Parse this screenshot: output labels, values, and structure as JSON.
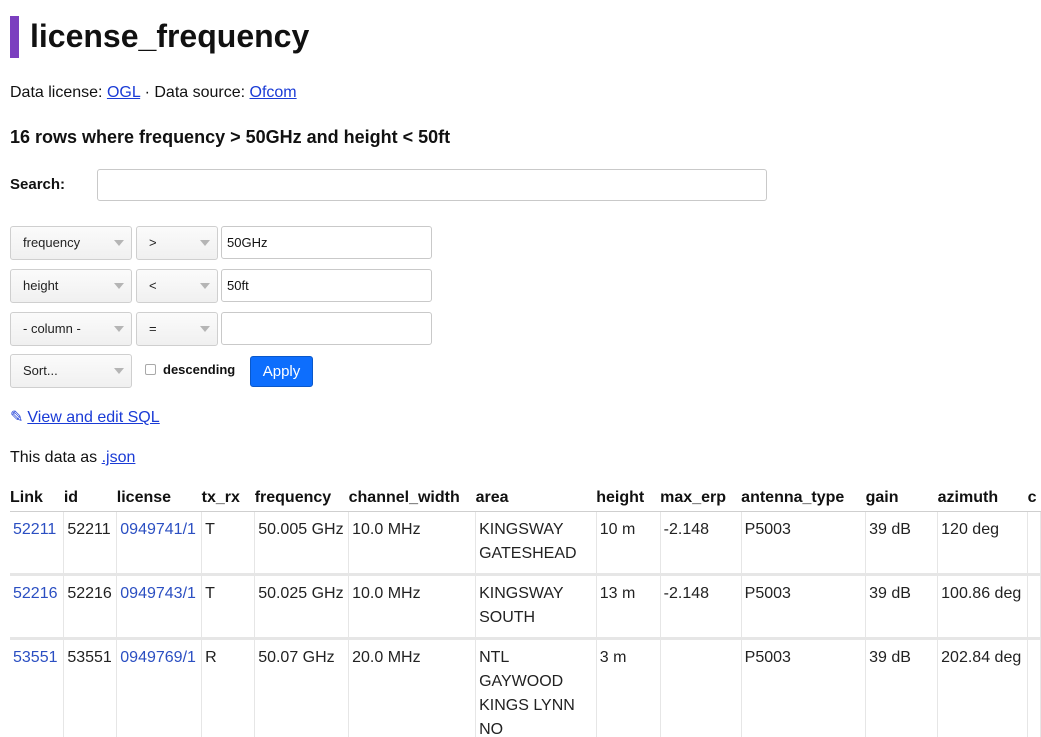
{
  "title": "license_frequency",
  "license_line": {
    "prefix": "Data license: ",
    "license_link": "OGL",
    "separator": " · Data source: ",
    "source_link": "Ofcom"
  },
  "rows_heading": "16 rows where frequency > 50GHz and height < 50ft",
  "search": {
    "label": "Search:",
    "value": ""
  },
  "filters": [
    {
      "column": "frequency",
      "operator": ">",
      "value": "50GHz"
    },
    {
      "column": "height",
      "operator": "<",
      "value": "50ft"
    },
    {
      "column": "- column -",
      "operator": "=",
      "value": ""
    }
  ],
  "sort": {
    "label": "Sort...",
    "descending_label": "descending",
    "descending_checked": false,
    "apply_label": "Apply"
  },
  "sql_link": {
    "icon": "✎",
    "label": "View and edit SQL"
  },
  "json_line": {
    "prefix": "This data as ",
    "link": ".json"
  },
  "table": {
    "columns": [
      "Link",
      "id",
      "license",
      "tx_rx",
      "frequency",
      "channel_width",
      "area",
      "height",
      "max_erp",
      "antenna_type",
      "gain",
      "azimuth",
      "c"
    ],
    "rows": [
      {
        "link": "52211",
        "id": "52211",
        "license": "0949741/1",
        "tx_rx": "T",
        "frequency": "50.005 GHz",
        "channel_width": "10.0 MHz",
        "area": [
          "KINGSWAY",
          "GATESHEAD"
        ],
        "height": "10 m",
        "max_erp": "-2.148",
        "antenna_type": "P5003",
        "gain": "39 dB",
        "azimuth": "120 deg"
      },
      {
        "link": "52216",
        "id": "52216",
        "license": "0949743/1",
        "tx_rx": "T",
        "frequency": "50.025 GHz",
        "channel_width": "10.0 MHz",
        "area": [
          "KINGSWAY",
          "SOUTH"
        ],
        "height": "13 m",
        "max_erp": "-2.148",
        "antenna_type": "P5003",
        "gain": "39 dB",
        "azimuth": "100.86 deg"
      },
      {
        "link": "53551",
        "id": "53551",
        "license": "0949769/1",
        "tx_rx": "R",
        "frequency": "50.07 GHz",
        "channel_width": "20.0 MHz",
        "area": [
          "NTL",
          "GAYWOOD",
          "KINGS LYNN",
          "NO"
        ],
        "height": "3 m",
        "max_erp": "",
        "antenna_type": "P5003",
        "gain": "39 dB",
        "azimuth": "202.84 deg"
      }
    ]
  },
  "colors": {
    "accent": "#7b3fbf",
    "link": "#1a3bd6",
    "button": "#0d6efd"
  }
}
